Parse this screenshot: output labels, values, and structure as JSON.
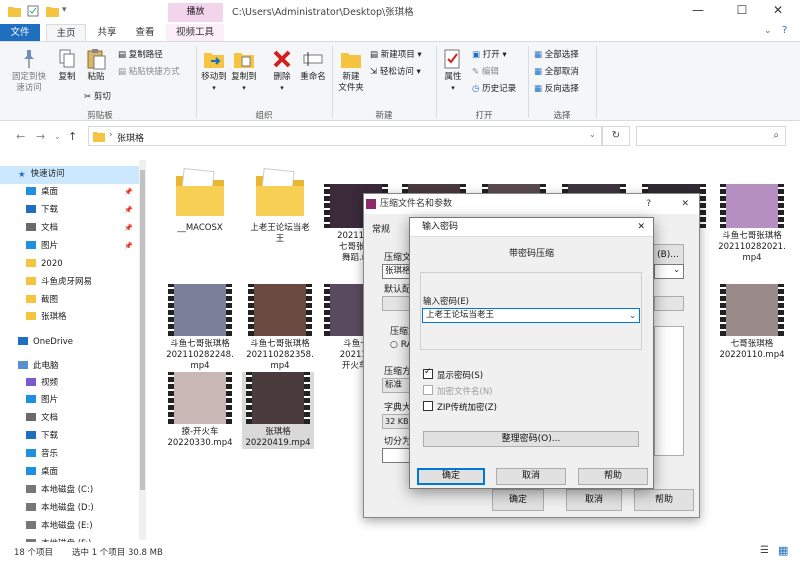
{
  "window": {
    "context_tab": "播放",
    "path_title": "C:\\Users\\Administrator\\Desktop\\张琪格",
    "minimize": "—",
    "maximize": "☐",
    "close": "✕"
  },
  "tabs": [
    "文件",
    "主页",
    "共享",
    "查看",
    "视频工具"
  ],
  "ribbon": {
    "clipboard": {
      "pin_label": "固定到快\n速访问",
      "copy_label": "复制",
      "paste_label": "粘贴",
      "copy_path": "复制路径",
      "paste_shortcut": "粘贴快捷方式",
      "cut": "剪切",
      "group": "剪贴板"
    },
    "organize": {
      "move_to": "移动到",
      "copy_to": "复制到",
      "delete": "删除",
      "rename": "重命名",
      "group": "组织"
    },
    "new": {
      "new_folder": "新建\n文件夹",
      "new_item": "新建项目 ▾",
      "easy_access": "轻松访问 ▾",
      "group": "新建"
    },
    "open": {
      "properties": "属性",
      "open": "打开 ▾",
      "edit": "编辑",
      "history": "历史记录",
      "group": "打开"
    },
    "select": {
      "select_all": "全部选择",
      "select_none": "全部取消",
      "invert": "反向选择",
      "group": "选择"
    }
  },
  "address": {
    "crumb": "张琪格",
    "search_placeholder": ""
  },
  "nav": [
    {
      "label": "快速访问",
      "kind": "star",
      "selected": true
    },
    {
      "label": "桌面",
      "kind": "desktop",
      "pinned": true
    },
    {
      "label": "下载",
      "kind": "download",
      "pinned": true
    },
    {
      "label": "文档",
      "kind": "doc",
      "pinned": true
    },
    {
      "label": "图片",
      "kind": "pic",
      "pinned": true
    },
    {
      "label": "2020",
      "kind": "folder"
    },
    {
      "label": "斗鱼虎牙网易",
      "kind": "folder"
    },
    {
      "label": "截图",
      "kind": "folder"
    },
    {
      "label": "张琪格",
      "kind": "folder"
    },
    {
      "label": "OneDrive",
      "kind": "cloud"
    },
    {
      "label": "此电脑",
      "kind": "pc"
    },
    {
      "label": "视频",
      "kind": "video"
    },
    {
      "label": "图片",
      "kind": "pic"
    },
    {
      "label": "文档",
      "kind": "doc"
    },
    {
      "label": "下载",
      "kind": "download"
    },
    {
      "label": "音乐",
      "kind": "music"
    },
    {
      "label": "桌面",
      "kind": "desktop"
    },
    {
      "label": "本地磁盘 (C:)",
      "kind": "drive"
    },
    {
      "label": "本地磁盘 (D:)",
      "kind": "drive"
    },
    {
      "label": "本地磁盘 (E:)",
      "kind": "drive"
    },
    {
      "label": "本地磁盘 (F:)",
      "kind": "drive"
    }
  ],
  "files": [
    {
      "name": "__MACOSX",
      "type": "folder"
    },
    {
      "name": "上老王论坛当老\n王",
      "type": "folder"
    },
    {
      "name": "2021102\n七哥张琪\n舞蹈.m",
      "type": "video",
      "tone": "#3a2a3a"
    },
    {
      "name": "",
      "type": "video",
      "tone": "#4b3a40"
    },
    {
      "name": "",
      "type": "video",
      "tone": "#5a4a50"
    },
    {
      "name": "",
      "type": "video",
      "tone": "#3f3540"
    },
    {
      "name": "",
      "type": "video",
      "tone": "#2f2a33"
    },
    {
      "name": "斗鱼七哥张琪格\n202110282021.\nmp4",
      "type": "video",
      "tone": "#b58fc0"
    },
    {
      "name": "斗鱼七哥张琪格\n202110282248.\nmp4",
      "type": "video",
      "tone": "#7a7f9a"
    },
    {
      "name": "斗鱼七哥张琪格\n202110282358.\nmp4",
      "type": "video",
      "tone": "#6a4a40"
    },
    {
      "name": "斗鱼七\n202110\n开火车.",
      "type": "video",
      "tone": "#5a4a60"
    },
    {
      "name": "七哥张琪格\n20220110.mp4",
      "type": "video",
      "tone": "#9a8a8a"
    },
    {
      "name": "撩-开火车\n20220330.mp4",
      "type": "video",
      "tone": "#c9b7b5"
    },
    {
      "name": "张琪格\n20220419.mp4",
      "type": "video",
      "tone": "#4a3c3c",
      "selected": true
    }
  ],
  "status": {
    "count": "18 个项目",
    "selected": "选中 1 个项目  30.8 MB"
  },
  "dialog_back": {
    "title": "压缩文件名和参数",
    "help_icon": "?",
    "close": "✕",
    "tab_general": "常规",
    "label_archive": "压缩文",
    "archive_value": "张琪格",
    "label_default": "默认配",
    "browse": "(B)...",
    "label_format": "压缩文",
    "radio_rar": "RA",
    "label_method": "压缩方",
    "method_value": "标准",
    "label_dict": "字典大",
    "dict_value": "32 KB",
    "label_split": "切分为",
    "ok": "确定",
    "cancel": "取消",
    "help": "帮助"
  },
  "dialog_front": {
    "title": "输入密码",
    "close": "✕",
    "heading": "带密码压缩",
    "password_label": "输入密码(E)",
    "password_value": "上老王论坛当老王",
    "show_password": "显示密码(S)",
    "encrypt_names": "加密文件名(N)",
    "zip_legacy": "ZIP传统加密(Z)",
    "organize": "整理密码(O)...",
    "ok": "确定",
    "cancel": "取消",
    "help": "帮助"
  },
  "colors": {
    "accent": "#1f6fc0",
    "context_tab": "#f2d4ec",
    "selection": "#cce8ff"
  }
}
